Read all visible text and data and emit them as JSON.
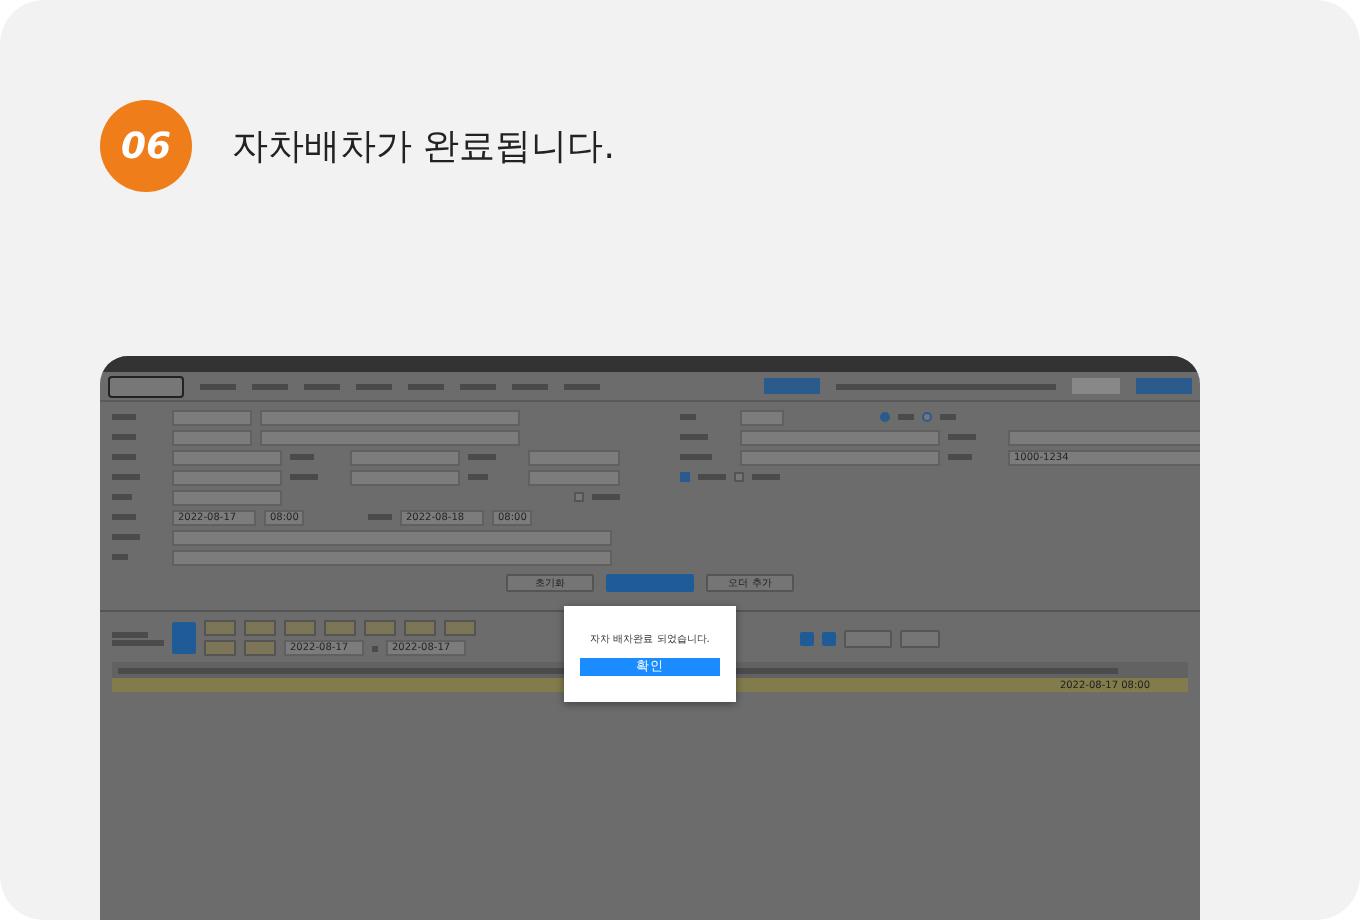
{
  "step": {
    "number": "06",
    "title": "자차배차가 완료됩니다."
  },
  "screenshot": {
    "form": {
      "start_date": "2022-08-17",
      "start_time": "08:00",
      "end_date": "2022-08-18",
      "end_time": "08:00",
      "phone": "1000-1234",
      "time_checkbox": {
        "checked": false
      },
      "radios": [
        {
          "selected": true
        },
        {
          "selected": false
        }
      ],
      "checkboxes": [
        {
          "checked": true
        },
        {
          "checked": false
        }
      ]
    },
    "buttons": [
      {
        "label": "초기화",
        "kind": "plain"
      },
      {
        "kind": "primary"
      },
      {
        "label": "오더 추가",
        "kind": "plain"
      }
    ],
    "filter": {
      "date_from": "2022-08-17",
      "date_to": "2022-08-17"
    },
    "row": {
      "date": "2022-08-17 08:00"
    },
    "dialog": {
      "message": "자차 배차완료 되었습니다.",
      "button": "확인"
    }
  }
}
